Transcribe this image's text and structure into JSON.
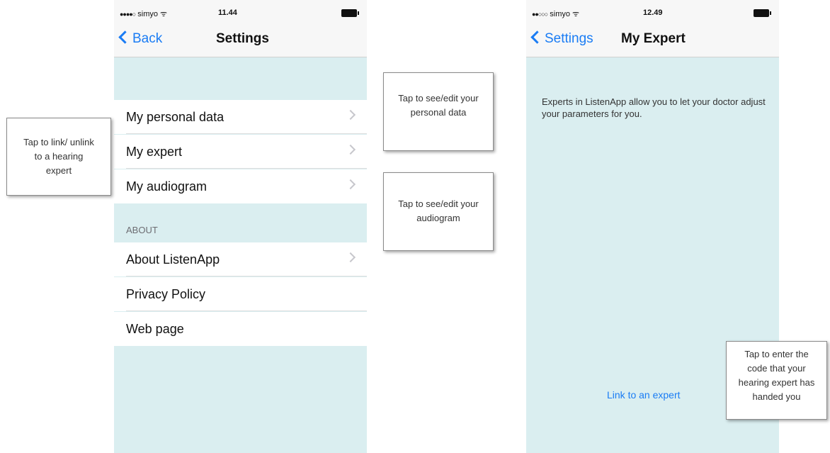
{
  "left_screen": {
    "status": {
      "carrier": "simyo",
      "dots": "●●●●○",
      "wifi": "ᯤ",
      "time": "11.44"
    },
    "nav": {
      "back_label": "Back",
      "title": "Settings"
    },
    "cells": [
      {
        "label": "My personal data"
      },
      {
        "label": "My expert"
      },
      {
        "label": "My audiogram"
      }
    ],
    "about_header": "ABOUT",
    "about_cells": [
      {
        "label": "About ListenApp"
      },
      {
        "label": "Privacy Policy"
      },
      {
        "label": "Web page"
      }
    ]
  },
  "right_screen": {
    "status": {
      "carrier": "simyo",
      "dots": "●●○○○",
      "wifi": "ᯤ",
      "time": "12.49"
    },
    "nav": {
      "back_label": "Settings",
      "title": "My Expert"
    },
    "description": "Experts in ListenApp allow you to let your doctor adjust your parameters for you.",
    "link_label": "Link to an expert"
  },
  "callouts": {
    "link_expert": "Tap to link/ unlink to a hearing expert",
    "personal_data": "Tap to see/edit your personal data",
    "audiogram": "Tap to see/edit your audiogram",
    "enter_code": "Tap to enter the code that your hearing expert has handed you"
  },
  "colors": {
    "accent": "#1a7cf4",
    "background": "#daeef0"
  }
}
